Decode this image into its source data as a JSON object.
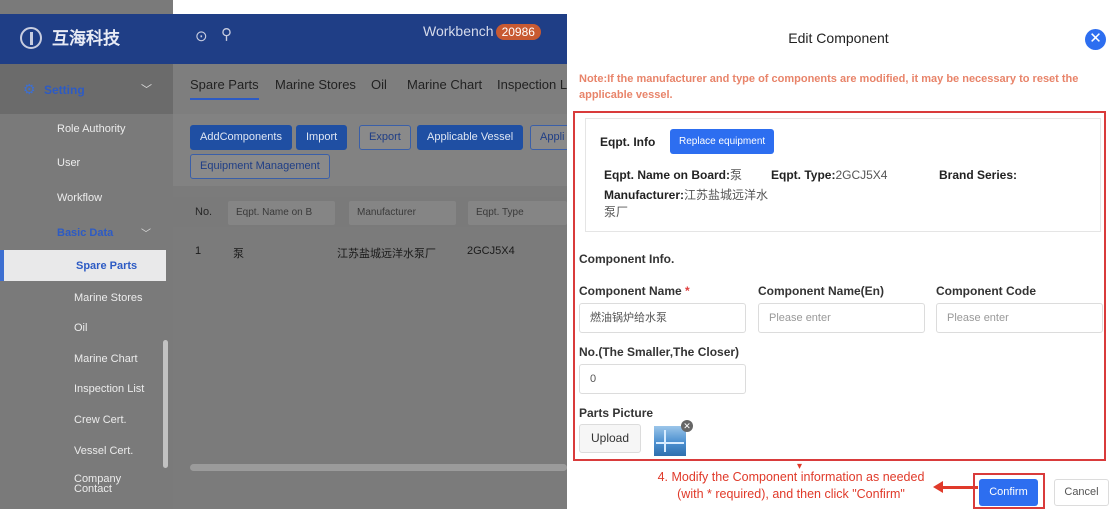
{
  "brand": {
    "name": "互海科技"
  },
  "topbar": {
    "workbench_label": "Workbench",
    "badge_count": "20986"
  },
  "sidebar": {
    "setting_label": "Setting",
    "items": [
      "Role Authority",
      "User",
      "Workflow"
    ],
    "basic_data_label": "Basic Data",
    "sub_items": [
      "Spare Parts",
      "Marine Stores",
      "Oil",
      "Marine Chart",
      "Inspection List",
      "Crew Cert.",
      "Vessel Cert.",
      "Company Contact"
    ]
  },
  "tabs": [
    "Spare Parts",
    "Marine Stores",
    "Oil",
    "Marine Chart",
    "Inspection L"
  ],
  "toolbar": {
    "add": "AddComponents",
    "import": "Import",
    "export": "Export",
    "applicable_vessel": "Applicable Vessel",
    "appli": "Appli",
    "equipment_management": "Equipment Management"
  },
  "table": {
    "headers": {
      "no": "No.",
      "eqpt_name": "Eqpt. Name on B",
      "manufacturer": "Manufacturer",
      "eqpt_type": "Eqpt. Type"
    },
    "rows": [
      {
        "no": "1",
        "name": "泵",
        "manufacturer": "江苏盐城远洋水泵厂",
        "type": "2GCJ5X4"
      }
    ]
  },
  "dialog": {
    "title": "Edit Component",
    "note": "Note:If the manufacturer and type of components are modified, it may be necessary to reset the applicable vessel.",
    "eqpt_info_title": "Eqpt. Info",
    "replace_button": "Replace equipment",
    "eqpt_name_label": "Eqpt. Name on Board:",
    "eqpt_name_value": "泵",
    "eqpt_type_label": "Eqpt. Type:",
    "eqpt_type_value": "2GCJ5X4",
    "brand_series_label": "Brand Series:",
    "manufacturer_label": "Manufacturer:",
    "manufacturer_value_1": "江苏盐城远洋水",
    "manufacturer_value_2": "泵厂",
    "component_info_title": "Component Info.",
    "component_name_label": "Component Name",
    "required_mark": "*",
    "component_name_value": "燃油锅炉给水泵",
    "component_name_en_label": "Component Name(En)",
    "component_name_en_placeholder": "Please enter",
    "component_code_label": "Component Code",
    "component_code_placeholder": "Please enter",
    "no_label": "No.(The Smaller,The Closer)",
    "no_value": "0",
    "parts_picture_label": "Parts Picture",
    "upload_button": "Upload",
    "confirm_button": "Confirm",
    "cancel_button": "Cancel"
  },
  "annotation": {
    "line1": "4. Modify the Component information as needed",
    "line2": "(with * required), and then click \"Confirm\""
  },
  "colors": {
    "primary": "#2d6ef0",
    "navy": "#1f3e86",
    "note": "#e8846a",
    "highlight": "#d93b3b"
  }
}
